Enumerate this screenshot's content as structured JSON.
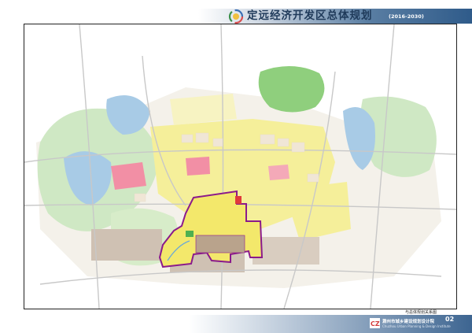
{
  "header": {
    "title": "定远经济开发区总体规划",
    "years": "(2016-2030)"
  },
  "map": {
    "caption": "与总体规划关系图"
  },
  "footer": {
    "page_number": "02",
    "institute_cn": "滁州市城乡建设规划设计院",
    "institute_en": "Chuzhou Urban Planning & Design Institute",
    "institute_logo_text": "CZ"
  },
  "colors": {
    "header_accent": "#2f5b8a",
    "development_zone_boundary": "#8b1a8b",
    "residential": "#f5ef9a",
    "industrial": "#b9a38c",
    "commercial": "#f28fa5",
    "greenland": "#7fc96b",
    "water": "#a8cbe6"
  }
}
